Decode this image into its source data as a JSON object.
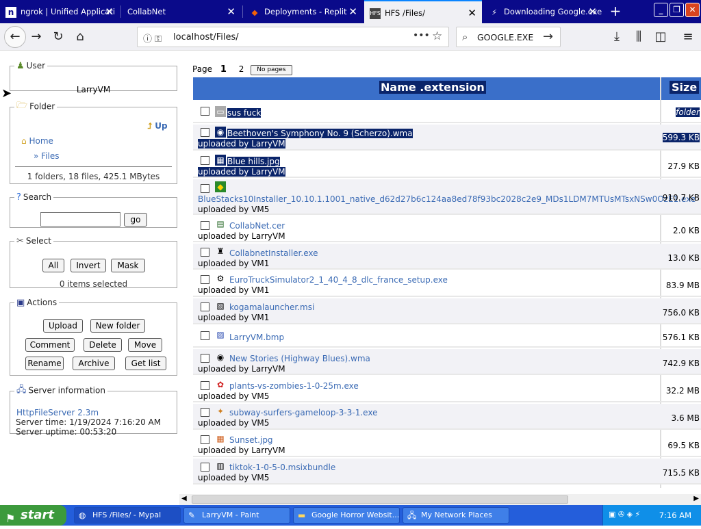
{
  "browser": {
    "tabs": [
      {
        "title": "ngrok | Unified Applicati",
        "icon": "ngrok-icon"
      },
      {
        "title": "CollabNet",
        "icon": ""
      },
      {
        "title": "Deployments - Replit",
        "icon": "replit-icon"
      },
      {
        "title": "HFS /Files/",
        "icon": "hfs-icon"
      },
      {
        "title": "Downloading Google.exe",
        "icon": "bolt-icon"
      }
    ],
    "url": "localhost/Files/",
    "search_value": "GOOGLE.EXE"
  },
  "user": {
    "legend": "User",
    "name": "LarryVM"
  },
  "folder": {
    "legend": "Folder",
    "up_label": "Up",
    "home_label": "Home",
    "current_label": "» Files",
    "summary": "1 folders, 18 files, 425.1 MBytes"
  },
  "search": {
    "legend": "Search",
    "go_label": "go",
    "value": ""
  },
  "select": {
    "legend": "Select",
    "all_label": "All",
    "invert_label": "Invert",
    "mask_label": "Mask",
    "status": "0 items selected"
  },
  "actions": {
    "legend": "Actions",
    "upload": "Upload",
    "new_folder": "New folder",
    "comment": "Comment",
    "delete": "Delete",
    "move": "Move",
    "rename": "Rename",
    "archive": "Archive",
    "get_list": "Get list"
  },
  "server": {
    "legend": "Server information",
    "link": "HttpFileServer 2.3m",
    "time": "Server time: 1/19/2024 7:16:20 AM",
    "uptime": "Server uptime: 00:53:20"
  },
  "pager": {
    "label": "Page",
    "current": "1",
    "next": "2",
    "nopages_label": "No pages"
  },
  "table": {
    "col_name": "Name .extension",
    "col_size": "Size",
    "rows": [
      {
        "name": "sus fuck",
        "uploaded": "",
        "size": "folder",
        "icon": "folder-icon",
        "selected": true
      },
      {
        "name": "Beethoven's Symphony No. 9 (Scherzo).wma",
        "uploaded": "uploaded by LarryVM",
        "size": "599.3 KB",
        "icon": "media-icon",
        "selected": true
      },
      {
        "name": "Blue hills.jpg",
        "uploaded": "uploaded by LarryVM",
        "size": "27.9 KB",
        "icon": "image-icon",
        "selected": true
      },
      {
        "name": "BlueStacks10Installer_10.10.1.1001_native_d62d27b6c124aa8ed78f93bc2028c2e9_MDs1LDM7MTUsMTsxNSw0OzE1.exe",
        "uploaded": "uploaded by VM5",
        "size": "910.7 KB",
        "icon": "bluestacks-icon",
        "selected": false
      },
      {
        "name": "CollabNet.cer",
        "uploaded": "uploaded by LarryVM",
        "size": "2.0 KB",
        "icon": "certificate-icon",
        "selected": false
      },
      {
        "name": "CollabnetInstaller.exe",
        "uploaded": "uploaded by VM1",
        "size": "13.0 KB",
        "icon": "installer-icon",
        "selected": false
      },
      {
        "name": "EuroTruckSimulator2_1_40_4_8_dlc_france_setup.exe",
        "uploaded": "uploaded by VM1",
        "size": "83.9 MB",
        "icon": "setup-icon",
        "selected": false
      },
      {
        "name": "kogamalauncher.msi",
        "uploaded": "uploaded by VM1",
        "size": "756.0 KB",
        "icon": "msi-icon",
        "selected": false
      },
      {
        "name": "LarryVM.bmp",
        "uploaded": "",
        "size": "576.1 KB",
        "icon": "bitmap-icon",
        "selected": false
      },
      {
        "name": "New Stories (Highway Blues).wma",
        "uploaded": "uploaded by LarryVM",
        "size": "742.9 KB",
        "icon": "media-icon",
        "selected": false
      },
      {
        "name": "plants-vs-zombies-1-0-25m.exe",
        "uploaded": "uploaded by VM5",
        "size": "32.2 MB",
        "icon": "game-icon",
        "selected": false
      },
      {
        "name": "subway-surfers-gameloop-3-3-1.exe",
        "uploaded": "uploaded by VM5",
        "size": "3.6 MB",
        "icon": "game-icon",
        "selected": false
      },
      {
        "name": "Sunset.jpg",
        "uploaded": "uploaded by LarryVM",
        "size": "69.5 KB",
        "icon": "image-icon",
        "selected": false
      },
      {
        "name": "tiktok-1-0-5-0.msixbundle",
        "uploaded": "uploaded by VM5",
        "size": "715.5 KB",
        "icon": "package-icon",
        "selected": false
      }
    ]
  },
  "taskbar": {
    "start_label": "start",
    "items": [
      {
        "label": "HFS /Files/ - Mypal",
        "icon": "browser-icon"
      },
      {
        "label": "LarryVM - Paint",
        "icon": "paint-icon"
      },
      {
        "label": "Google Horror Websit...",
        "icon": "folder-icon"
      },
      {
        "label": "My Network Places",
        "icon": "network-icon"
      }
    ],
    "clock": "7:16 AM"
  },
  "colors": {
    "tabbar": "#0a0a8a",
    "table_header": "#3a6fc9",
    "selection": "#0a246a",
    "link": "#3a6ab4",
    "taskbar": "#245edb"
  }
}
